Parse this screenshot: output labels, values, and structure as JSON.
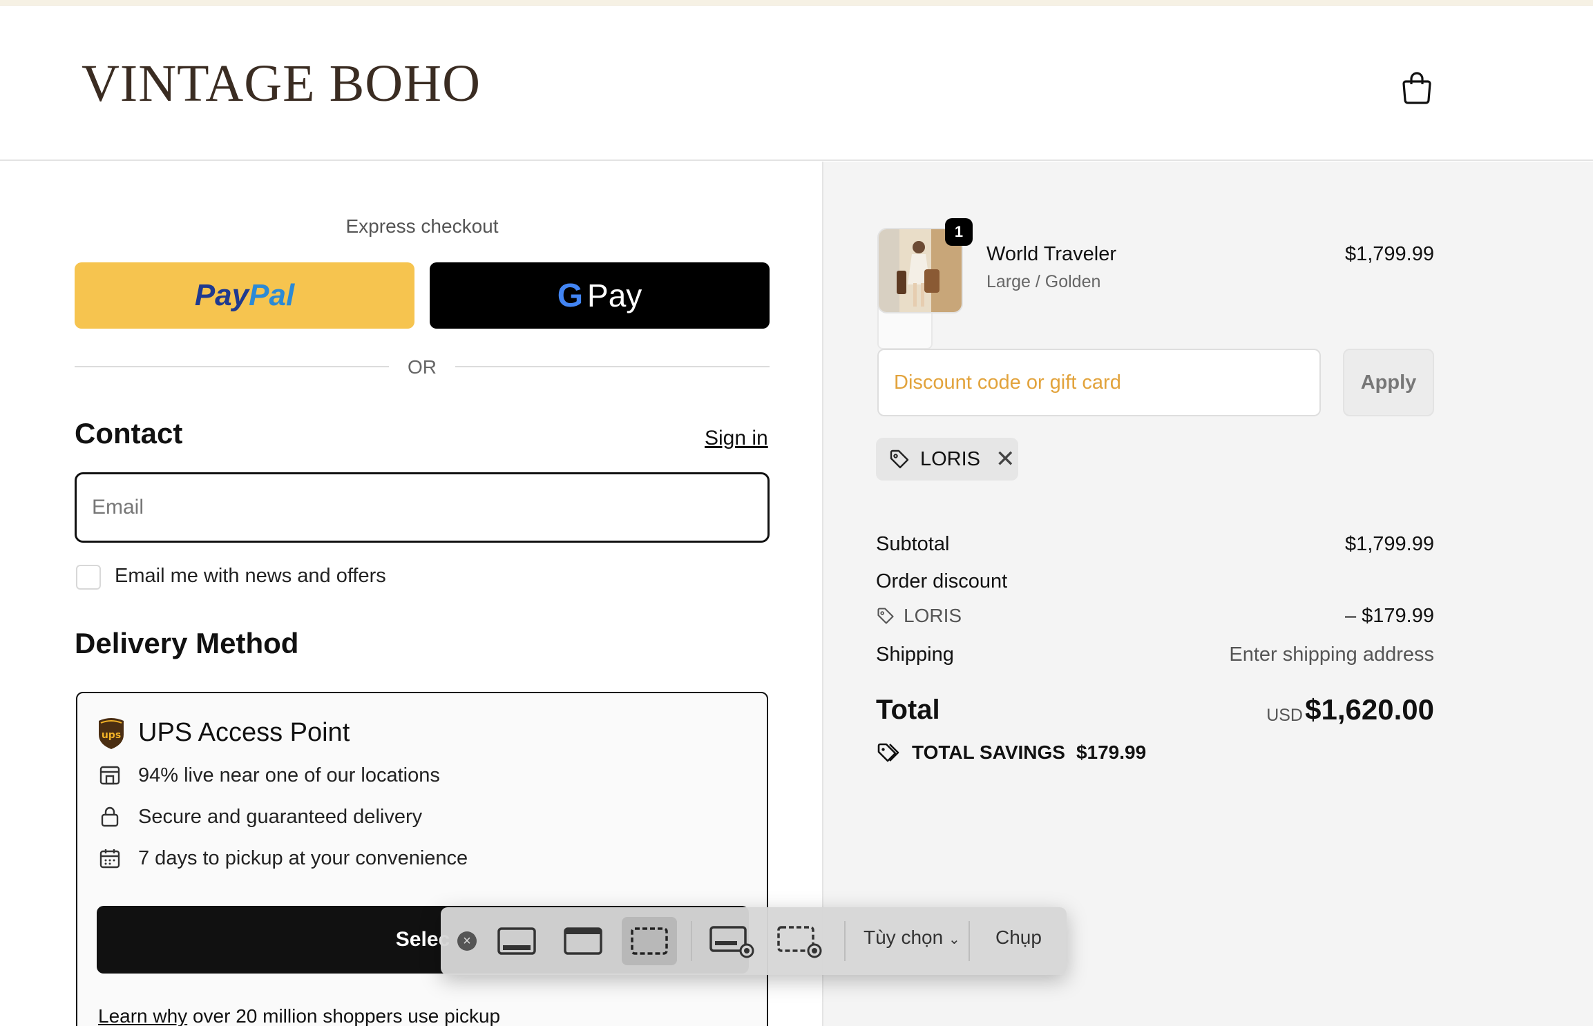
{
  "store": {
    "logo": "VINTAGE BOHO"
  },
  "express": {
    "label": "Express checkout",
    "paypal_part1": "Pay",
    "paypal_part2": "Pal",
    "gpay_g": "G",
    "gpay_label": "Pay",
    "or_label": "OR"
  },
  "contact": {
    "title": "Contact",
    "signin": "Sign in",
    "email_placeholder": "Email",
    "newsletter_label": "Email me with news and offers"
  },
  "delivery": {
    "title": "Delivery Method",
    "option_title": "UPS Access Point",
    "features": [
      "94% live near one of our locations",
      "Secure and guaranteed delivery",
      "7 days to pickup at your convenience"
    ],
    "select_label": "Selec",
    "learn_link": "Learn why",
    "learn_rest": " over 20 million shoppers use pickup"
  },
  "order": {
    "item": {
      "name": "World Traveler",
      "variant": "Large / Golden",
      "price": "$1,799.99",
      "quantity": "1"
    },
    "discount_placeholder": "Discount code or gift card",
    "apply_label": "Apply",
    "applied_code": "LORIS",
    "subtotal_label": "Subtotal",
    "subtotal_value": "$1,799.99",
    "order_discount_label": "Order discount",
    "discount_code": "LORIS",
    "discount_value": "– $179.99",
    "shipping_label": "Shipping",
    "shipping_value": "Enter shipping address",
    "total_label": "Total",
    "currency": "USD",
    "total_value": "$1,620.00",
    "savings_label": "TOTAL SAVINGS",
    "savings_value": "$179.99"
  },
  "toolbar": {
    "options_label": "Tùy chọn",
    "capture_label": "Chụp"
  },
  "colors": {
    "paypal_yellow": "#f6c44f",
    "placeholder_orange": "#e2a33c",
    "logo_brown": "#3a2c22",
    "summary_bg": "#f4f4f4"
  }
}
